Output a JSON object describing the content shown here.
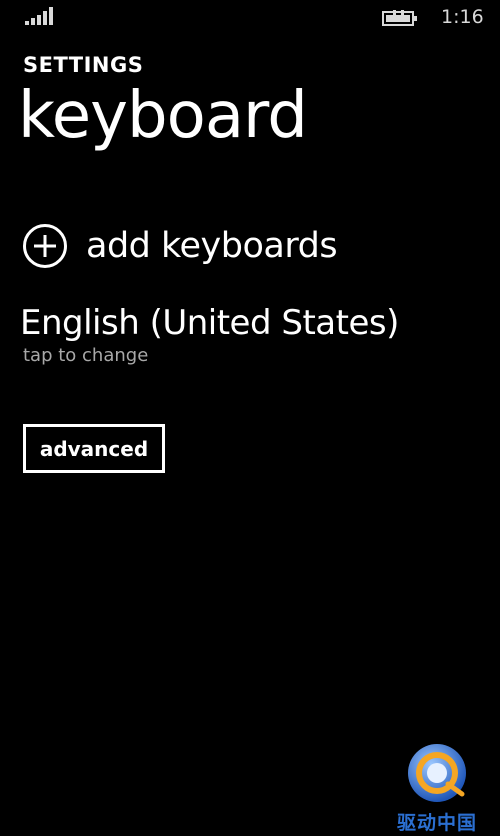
{
  "status_bar": {
    "time": "1:16",
    "signal_icon": "signal-bars-icon",
    "battery_icon": "battery-charging-icon"
  },
  "header": {
    "app_title": "SETTINGS",
    "page_title": "keyboard"
  },
  "add_keyboards": {
    "icon": "plus-circle-icon",
    "label": "add keyboards"
  },
  "language": {
    "name": "English (United States)",
    "hint": "tap to change"
  },
  "advanced_button": {
    "label": "advanced"
  },
  "watermark": {
    "text": "驱动中国",
    "logo_icon": "drivers-china-logo"
  },
  "colors": {
    "background": "#000000",
    "foreground": "#ffffff",
    "subtle_text": "#a8a8a8",
    "watermark_blue": "#2b6fd1",
    "watermark_orange": "#f5a623"
  }
}
